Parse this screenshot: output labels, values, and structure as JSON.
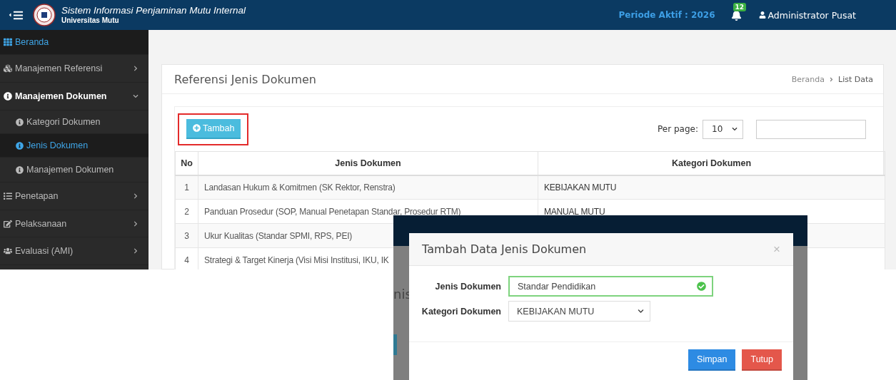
{
  "header": {
    "title": "Sistem Informasi Penjaminan Mutu Internal",
    "subtitle": "Universitas Mutu",
    "period": "Periode Aktif : 2026",
    "notifications": "12",
    "user": "Administrator Pusat"
  },
  "sidebar": {
    "items": [
      {
        "label": "Beranda",
        "kind": "link",
        "selected": true
      },
      {
        "label": "Manajemen Referensi",
        "kind": "menu",
        "selected": false,
        "expanded": false
      },
      {
        "label": "Manajemen Dokumen",
        "kind": "menu",
        "selected": false,
        "expanded": true,
        "children": [
          {
            "label": "Kategori Dokumen",
            "selected": false
          },
          {
            "label": "Jenis Dokumen",
            "selected": true
          },
          {
            "label": "Manajemen Dokumen",
            "selected": false
          }
        ]
      },
      {
        "label": "Penetapan",
        "kind": "menu",
        "selected": false,
        "expanded": false
      },
      {
        "label": "Pelaksanaan",
        "kind": "menu",
        "selected": false,
        "expanded": false
      },
      {
        "label": "Evaluasi (AMI)",
        "kind": "menu",
        "selected": false,
        "expanded": false
      }
    ]
  },
  "page": {
    "title": "Referensi Jenis Dokumen",
    "breadcrumb": [
      "Beranda",
      "List Data"
    ]
  },
  "toolbar": {
    "add_button": {
      "label": "Tambah",
      "highlighted": true
    },
    "per_page_label": "Per page:",
    "per_page": "10"
  },
  "table": {
    "columns": [
      "No",
      "Jenis Dokumen",
      "Kategori Dokumen"
    ],
    "rows": [
      {
        "no": "1",
        "jenis": "Landasan Hukum & Komitmen (SK Rektor, Renstra)",
        "kategori": "KEBIJAKAN MUTU"
      },
      {
        "no": "2",
        "jenis": "Panduan Prosedur (SOP, Manual Penetapan Standar, Prosedur RTM)",
        "kategori": "MANUAL MUTU"
      },
      {
        "no": "3",
        "jenis": "Ukur Kualitas (Standar SPMI, RPS, PEI)"
      },
      {
        "no": "4",
        "jenis": "Strategi & Target Kinerja (Visi Misi Institusi, IKU, IK"
      }
    ]
  },
  "inset": {
    "background_text": "nis",
    "modal": {
      "title": "Tambah Data Jenis Dokumen",
      "close": "×",
      "fields": [
        {
          "label": "Jenis Dokumen",
          "kind": "text",
          "value": "Standar Pendidikan",
          "valid": true
        },
        {
          "label": "Kategori Dokumen",
          "kind": "select",
          "value": "KEBIJAKAN MUTU",
          "valid": false
        }
      ],
      "buttons": [
        {
          "label": "Simpan",
          "kind": "primary"
        },
        {
          "label": "Tutup",
          "kind": "danger"
        }
      ]
    }
  }
}
